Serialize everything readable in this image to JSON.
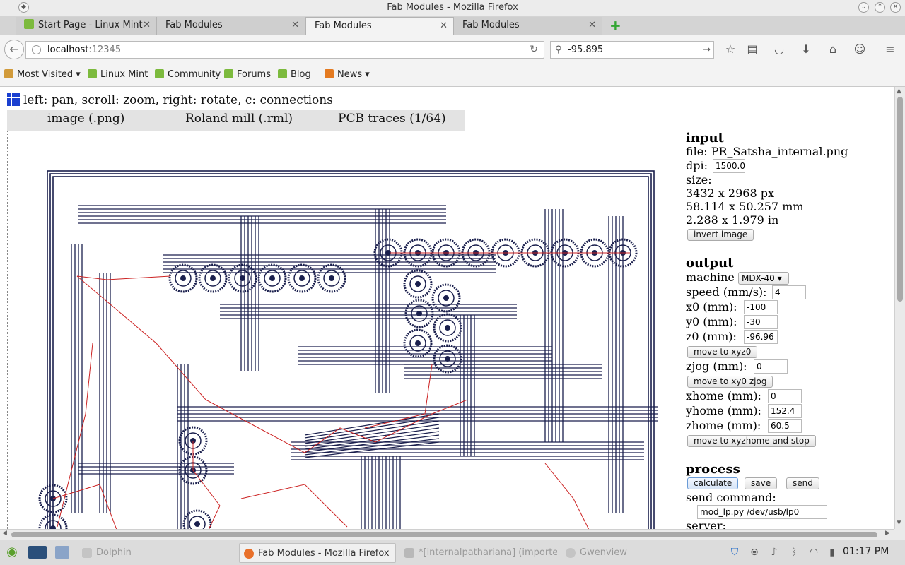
{
  "window": {
    "title": "Fab Modules - Mozilla Firefox"
  },
  "tabs": [
    {
      "label": "Start Page - Linux Mint"
    },
    {
      "label": "Fab Modules"
    },
    {
      "label": "Fab Modules"
    },
    {
      "label": "Fab Modules"
    }
  ],
  "nav": {
    "url_host": "localhost",
    "url_port": ":12345",
    "search_value": "-95.895"
  },
  "bookmarks": [
    {
      "label": "Most Visited"
    },
    {
      "label": "Linux Mint"
    },
    {
      "label": "Community"
    },
    {
      "label": "Forums"
    },
    {
      "label": "Blog"
    },
    {
      "label": "News"
    }
  ],
  "page": {
    "hint": "left: pan, scroll: zoom, right: rotate, c: connections",
    "menu": [
      "image (.png)",
      "Roland mill (.rml)",
      "PCB traces (1/64)"
    ]
  },
  "input": {
    "heading": "input",
    "file": "file: PR_Satsha_internal.png",
    "dpi_label": "dpi:",
    "dpi_value": "1500.0",
    "size_label": "size:",
    "size_px": "3432 x 2968 px",
    "size_mm": "58.114 x 50.257 mm",
    "size_in": "2.288 x 1.979 in",
    "invert_button": "invert image"
  },
  "output": {
    "heading": "output",
    "machine_label": "machine",
    "machine_value": "MDX-40",
    "speed_label": "speed (mm/s):",
    "speed_value": "4",
    "x0_label": "x0 (mm):",
    "x0_value": "-100",
    "y0_label": "y0 (mm):",
    "y0_value": "-30",
    "z0_label": "z0 (mm):",
    "z0_value": "-96.96",
    "move_xyz0": "move to xyz0",
    "zjog_label": "zjog (mm):",
    "zjog_value": "0",
    "move_xy0_zjog": "move to xy0 zjog",
    "xhome_label": "xhome (mm):",
    "xhome_value": "0",
    "yhome_label": "yhome (mm):",
    "yhome_value": "152.4",
    "zhome_label": "zhome (mm):",
    "zhome_value": "60.5",
    "move_xyzhome": "move to xyzhome and stop"
  },
  "process": {
    "heading": "process",
    "calculate": "calculate",
    "save": "save",
    "send": "send",
    "send_command_label": "send command:",
    "send_command_value": "mod_lp.py /dev/usb/lp0",
    "server_label": "server:"
  },
  "taskbar": {
    "items": [
      {
        "label": "Dolphin"
      },
      {
        "label": "Fab Modules - Mozilla Firefox"
      },
      {
        "label": "*[internalpathariana] (imported)"
      },
      {
        "label": "Gwenview"
      }
    ],
    "clock": "01:17 PM"
  },
  "colors": {
    "trace": "#1a1f4d",
    "path": "#cc2222",
    "accent": "#1a3fd0"
  }
}
